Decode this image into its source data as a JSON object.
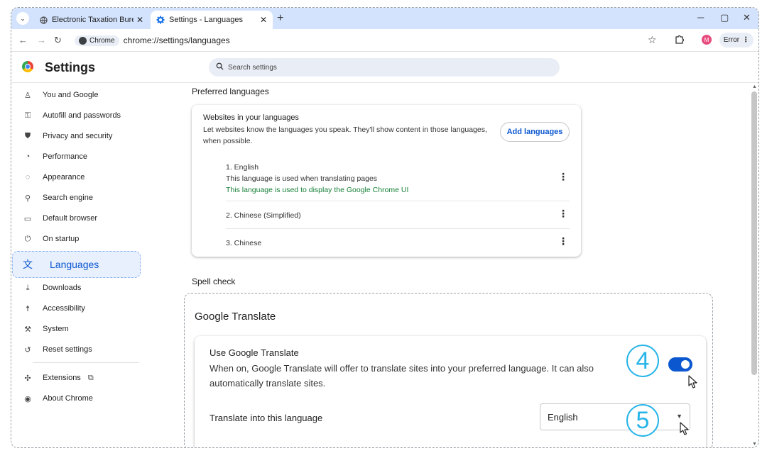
{
  "tabs": [
    {
      "title": "Electronic Taxation Bureau fo",
      "active": false
    },
    {
      "title": "Settings - Languages",
      "active": true
    }
  ],
  "toolbar": {
    "chip_label": "Chrome",
    "url": "chrome://settings/languages",
    "profile_initial": "M",
    "error_label": "Error"
  },
  "header": {
    "title": "Settings",
    "search_placeholder": "Search settings"
  },
  "sidebar": {
    "items": [
      {
        "label": "You and Google",
        "icon": "person-icon"
      },
      {
        "label": "Autofill and passwords",
        "icon": "key-icon"
      },
      {
        "label": "Privacy and security",
        "icon": "shield-icon"
      },
      {
        "label": "Performance",
        "icon": "speedometer-icon"
      },
      {
        "label": "Appearance",
        "icon": "palette-icon"
      },
      {
        "label": "Search engine",
        "icon": "search-icon"
      },
      {
        "label": "Default browser",
        "icon": "browser-icon"
      },
      {
        "label": "On startup",
        "icon": "power-icon"
      },
      {
        "label": "Languages",
        "icon": "translate-icon",
        "selected": true
      },
      {
        "label": "Downloads",
        "icon": "download-icon"
      },
      {
        "label": "Accessibility",
        "icon": "accessibility-icon"
      },
      {
        "label": "System",
        "icon": "wrench-icon"
      },
      {
        "label": "Reset settings",
        "icon": "reset-icon"
      },
      {
        "label": "Extensions",
        "icon": "puzzle-icon"
      },
      {
        "label": "About Chrome",
        "icon": "chrome-icon"
      }
    ]
  },
  "preferred": {
    "section_title": "Preferred languages",
    "card_title": "Websites in your languages",
    "card_desc": "Let websites know the languages you speak. They'll show content in those languages, when possible.",
    "add_button": "Add languages",
    "languages": [
      {
        "name": "1. English",
        "note1": "This language is used when translating pages",
        "note2": "This language is used to display the Google Chrome UI"
      },
      {
        "name": "2. Chinese (Simplified)"
      },
      {
        "name": "3. Chinese"
      }
    ]
  },
  "spell": {
    "section_title": "Spell check"
  },
  "translate": {
    "section_title": "Google Translate",
    "use_title": "Use Google Translate",
    "use_desc": "When on, Google Translate will offer to translate sites into your preferred language. It can also automatically translate sites.",
    "toggle_on": true,
    "into_label": "Translate into this language",
    "into_value": "English"
  },
  "callouts": {
    "first": "4",
    "second": "5"
  },
  "colors": {
    "accent": "#0b57d0",
    "callout": "#27b4e8",
    "green_note": "#188038"
  }
}
